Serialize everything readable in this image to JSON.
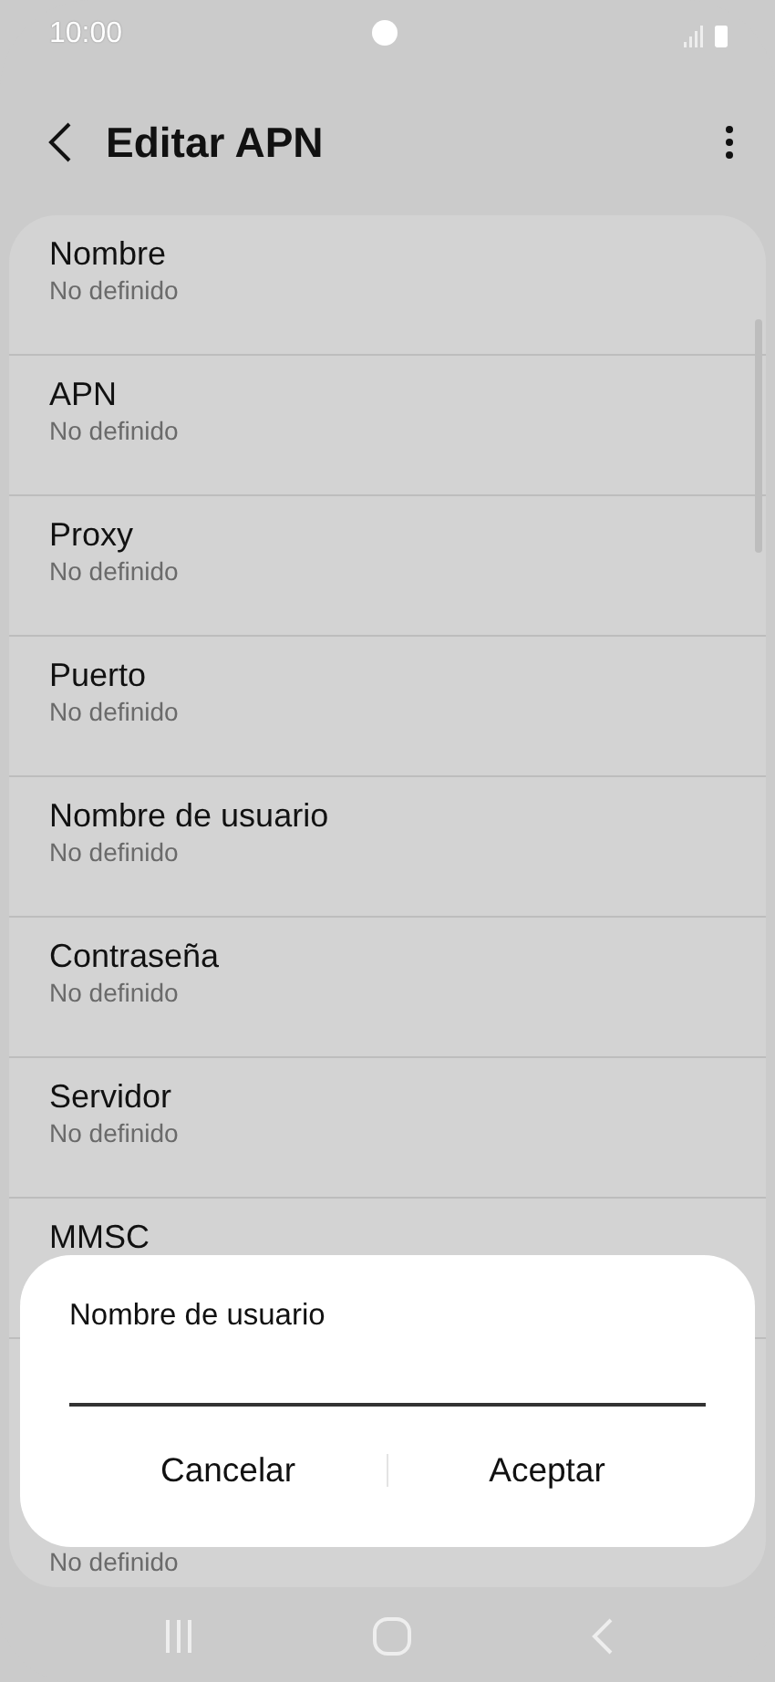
{
  "status_bar": {
    "time": "10:00"
  },
  "header": {
    "title": "Editar APN"
  },
  "items": [
    {
      "title": "Nombre",
      "subtitle": "No definido"
    },
    {
      "title": "APN",
      "subtitle": "No definido"
    },
    {
      "title": "Proxy",
      "subtitle": "No definido"
    },
    {
      "title": "Puerto",
      "subtitle": "No definido"
    },
    {
      "title": "Nombre de usuario",
      "subtitle": "No definido"
    },
    {
      "title": "Contraseña",
      "subtitle": "No definido"
    },
    {
      "title": "Servidor",
      "subtitle": "No definido"
    },
    {
      "title": "MMSC"
    },
    {
      "subtitle": "No definido"
    }
  ],
  "dialog": {
    "title": "Nombre de usuario",
    "buttons": [
      "Cancelar",
      "Aceptar"
    ]
  }
}
